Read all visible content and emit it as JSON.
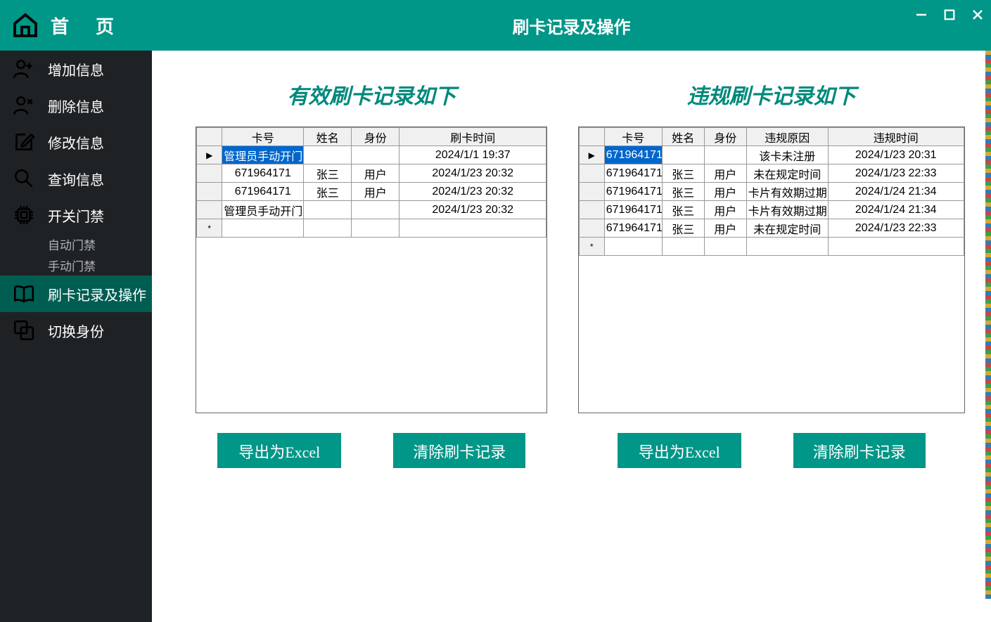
{
  "sidebar": {
    "home": "首　页",
    "items": [
      {
        "label": "增加信息"
      },
      {
        "label": "删除信息"
      },
      {
        "label": "修改信息"
      },
      {
        "label": "查询信息"
      },
      {
        "label": "开关门禁"
      },
      {
        "label": "刷卡记录及操作"
      },
      {
        "label": "切换身份"
      }
    ],
    "subs": {
      "auto": "自动门禁",
      "manual": "手动门禁"
    }
  },
  "titlebar": {
    "title": "刷卡记录及操作"
  },
  "valid": {
    "title": "有效刷卡记录如下",
    "headers": {
      "card": "卡号",
      "name": "姓名",
      "role": "身份",
      "time": "刷卡时间"
    },
    "rows": [
      {
        "card": "管理员手动开门",
        "name": "",
        "role": "",
        "time": "2024/1/1 19:37"
      },
      {
        "card": "671964171",
        "name": "张三",
        "role": "用户",
        "time": "2024/1/23 20:32"
      },
      {
        "card": "671964171",
        "name": "张三",
        "role": "用户",
        "time": "2024/1/23 20:32"
      },
      {
        "card": "管理员手动开门",
        "name": "",
        "role": "",
        "time": "2024/1/23 20:32"
      }
    ],
    "buttons": {
      "export": "导出为Excel",
      "clear": "清除刷卡记录"
    }
  },
  "invalid": {
    "title": "违规刷卡记录如下",
    "headers": {
      "card": "卡号",
      "name": "姓名",
      "role": "身份",
      "reason": "违规原因",
      "time": "违规时间"
    },
    "rows": [
      {
        "card": "671964171",
        "name": "",
        "role": "",
        "reason": "该卡未注册",
        "time": "2024/1/23 20:31"
      },
      {
        "card": "671964171",
        "name": "张三",
        "role": "用户",
        "reason": "未在规定时间",
        "time": "2024/1/23 22:33"
      },
      {
        "card": "671964171",
        "name": "张三",
        "role": "用户",
        "reason": "卡片有效期过期",
        "time": "2024/1/24 21:34"
      },
      {
        "card": "671964171",
        "name": "张三",
        "role": "用户",
        "reason": "卡片有效期过期",
        "time": "2024/1/24 21:34"
      },
      {
        "card": "671964171",
        "name": "张三",
        "role": "用户",
        "reason": "未在规定时间",
        "time": "2024/1/23 22:33"
      }
    ],
    "buttons": {
      "export": "导出为Excel",
      "clear": "清除刷卡记录"
    }
  }
}
